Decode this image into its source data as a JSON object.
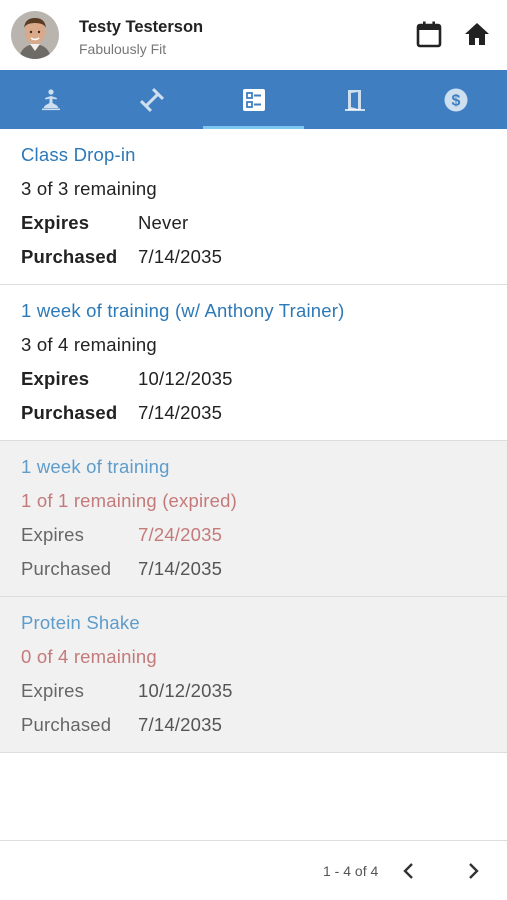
{
  "header": {
    "user_name": "Testy Testerson",
    "org_name": "Fabulously Fit",
    "avatar_icon": "user-avatar",
    "calendar_icon": "calendar-icon",
    "home_icon": "home-icon"
  },
  "tabs": [
    {
      "icon": "meditation-icon",
      "active": false
    },
    {
      "icon": "workout-icon",
      "active": false
    },
    {
      "icon": "passes-icon",
      "active": true
    },
    {
      "icon": "door-icon",
      "active": false
    },
    {
      "icon": "dollar-icon",
      "active": false
    }
  ],
  "colors": {
    "tab_bar": "#3f7fc1",
    "tab_indicator": "#7ec8ef",
    "title_link": "#2d79b7",
    "expired_text": "#c47a7a"
  },
  "passes": [
    {
      "title": "Class Drop-in",
      "remaining": "3 of 3 remaining",
      "expires_label": "Expires",
      "expires": "Never",
      "purchased_label": "Purchased",
      "purchased": "7/14/2035",
      "expired": false
    },
    {
      "title": "1 week of training (w/ Anthony Trainer)",
      "remaining": "3 of 4 remaining",
      "expires_label": "Expires",
      "expires": "10/12/2035",
      "purchased_label": "Purchased",
      "purchased": "7/14/2035",
      "expired": false
    },
    {
      "title": "1 week of training",
      "remaining": "1 of 1 remaining (expired)",
      "expires_label": "Expires",
      "expires": "7/24/2035",
      "purchased_label": "Purchased",
      "purchased": "7/14/2035",
      "expired": true
    },
    {
      "title": "Protein Shake",
      "remaining": "0 of 4 remaining",
      "expires_label": "Expires",
      "expires": "10/12/2035",
      "purchased_label": "Purchased",
      "purchased": "7/14/2035",
      "expired": true
    }
  ],
  "pager": {
    "range": "1 - 4 of 4",
    "prev_icon": "chevron-left-icon",
    "next_icon": "chevron-right-icon"
  }
}
